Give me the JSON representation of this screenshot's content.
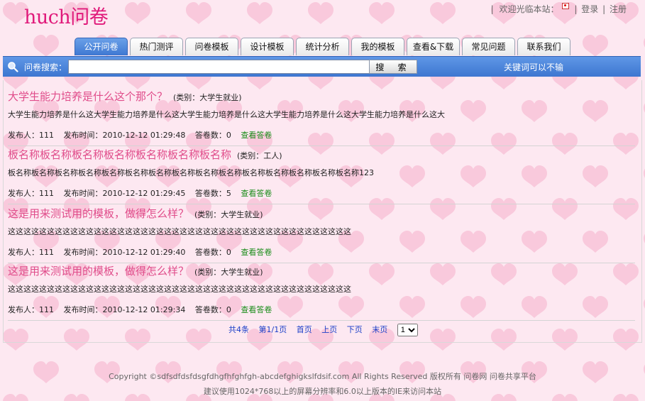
{
  "header": {
    "logo": "huch问卷",
    "links": [
      "欢迎光临本站：",
      "登录",
      "注册"
    ]
  },
  "tabs": [
    "公开问卷",
    "热门测评",
    "问卷模板",
    "设计模板",
    "统计分析",
    "我的模板",
    "查看&下载",
    "常见问题",
    "联系我们"
  ],
  "search": {
    "label": "问卷搜索：",
    "value": "",
    "button": "搜 索",
    "tip": "关键词可以不输"
  },
  "items": [
    {
      "title": "大学生能力培养是什么这个那个？",
      "category": "(类别：大学生就业)",
      "desc": "大学生能力培养是什么这大学生能力培养是什么这大学生能力培养是什么这大学生能力培养是什么这大学生能力培养是什么这大",
      "publisher": "发布人：111",
      "time": "发布时间：2010-12-12 01:29:48",
      "count": "答卷数：0",
      "view": "查看答卷"
    },
    {
      "title": "板名称板名称板名称板名称板名称板名称板名称",
      "category": "(类别：工人)",
      "desc": "板名称板名称板名称板名称板名称板名称板名称板名称板名称板名称板名称板名称板名称板名称板名称123",
      "publisher": "发布人：111",
      "time": "发布时间：2010-12-12 01:29:45",
      "count": "答卷数：5",
      "view": "查看答卷"
    },
    {
      "title": "这是用来测试用的模板，做得怎么样？",
      "category": "(类别：大学生就业)",
      "desc": "这这这这这这这这这这这这这这这这这这这这这这这这这这这这这这这这这这这这这这这这这这这这",
      "publisher": "发布人：111",
      "time": "发布时间：2010-12-12 01:29:40",
      "count": "答卷数：0",
      "view": "查看答卷"
    },
    {
      "title": "这是用来测试用的模板，做得怎么样？",
      "category": "(类别：大学生就业)",
      "desc": "这这这这这这这这这这这这这这这这这这这这这这这这这这这这这这这这这这这这这这这这这这这这",
      "publisher": "发布人：111",
      "time": "发布时间：2010-12-12 01:29:34",
      "count": "答卷数：0",
      "view": "查看答卷"
    }
  ],
  "pager": {
    "total": "共4条",
    "page": "第1/1页",
    "first": "首页",
    "prev": "上页",
    "next": "下页",
    "last": "末页",
    "selected": "1"
  },
  "footer": {
    "copyright": "Copyright ©sdfsdfdsfdsgfdhgfhfghfgh-abcdefghigkslfdsif.com All Rights Reserved 版权所有 问卷网 问卷共享平台",
    "note": "建议使用1024*768以上的屏幕分辨率和6.0以上版本的IE来访问本站"
  },
  "colors": {
    "accent": "#e04c8a",
    "bar": "#3d76d0",
    "link": "#1a8c1a",
    "bg": "#fde8f1"
  }
}
